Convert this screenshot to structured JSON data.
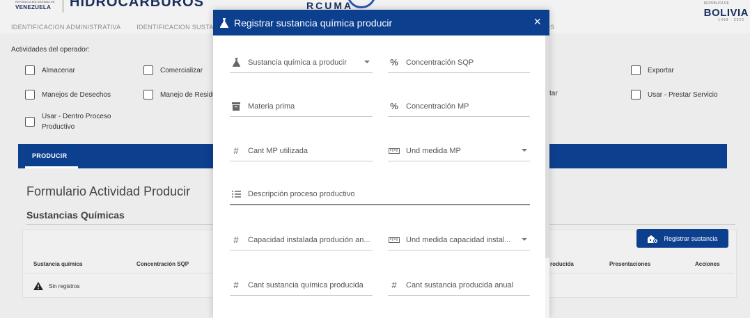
{
  "header": {
    "logo_small": "REPÚBLICA BOLIVARIANA DE",
    "logo_country": "VENEZUELA",
    "logo_name": "HIDROCARBUROS",
    "tabs": [
      "IDENTIFICACION ADMINISTRATIVA",
      "IDENTIFICACION SUSTAN"
    ],
    "tab_right": "OS",
    "top_deco": "RCUMA",
    "bolivia_small": "REPÚBLICA DE",
    "bolivia_word": "BOLIVIA",
    "bolivia_dates": "1499 - 2022"
  },
  "activities": {
    "label": "Actividades del operador:",
    "items": [
      "Almacenar",
      "Comercializar",
      "Exportar",
      "Manejos de Desechos",
      "Manejo de Residu",
      "tar",
      "Usar - Prestar Servicio",
      "Usar - Dentro Proceso",
      "Productivo"
    ]
  },
  "producir": {
    "tab": "PRODUCIR"
  },
  "form": {
    "title": "Formulario Actividad Producir",
    "subtitle": "Sustancias Químicas",
    "register_button": "Registrar sustancia",
    "columns": [
      "Sustancia química",
      "Concentración SQP",
      "roducida",
      "Presentaciones",
      "Acciones"
    ],
    "empty": "Sin registros"
  },
  "modal": {
    "title": "Registrar sustancia química producir",
    "close": "×",
    "fields": {
      "sustancia": "Sustancia química a producir",
      "concentracion_sqp": "Concentración SQP",
      "materia_prima": "Materia prima",
      "concentracion_mp": "Concentración MP",
      "cant_mp": "Cant MP utilizada",
      "und_medida_mp": "Und medida MP",
      "descripcion": "Descripción proceso productivo",
      "capacidad": "Capacidad instalada produción an...",
      "und_capacidad": "Und medida capacidad instal...",
      "cant_sustancia": "Cant sustancia química producida",
      "cant_anual": "Cant sustancia producida anual"
    }
  },
  "colors": {
    "primary": "#0d3f8f",
    "background": "#ececec"
  }
}
